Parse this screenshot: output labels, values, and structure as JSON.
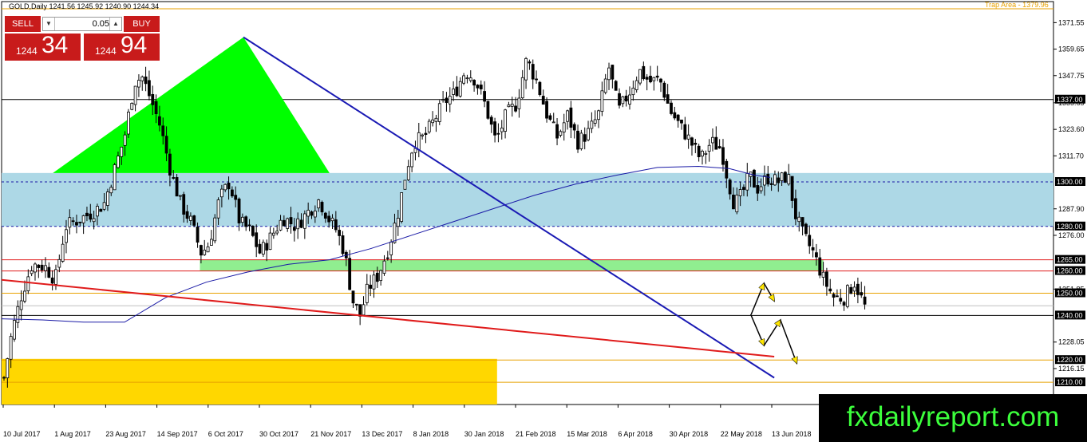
{
  "header": {
    "symbol_title": "GOLD,Daily  1241.56 1245.92 1240.90 1244.34",
    "trap_label": "Trap Area - 1379.96"
  },
  "trade_panel": {
    "sell_label": "SELL",
    "buy_label": "BUY",
    "lot_value": "0.05",
    "sell_small": "1244",
    "sell_big": "34",
    "buy_small": "1244",
    "buy_big": "94"
  },
  "watermark": "fxdailyreport.com",
  "colors": {
    "candle": "#000000",
    "ma": "#1a1aa6",
    "support_zone": "#add8e6",
    "demand_zone": "#90ee90",
    "yellow_zone": "#ffd700",
    "triangle": "#00ff00",
    "trendline": "#1a1ab4",
    "red_line": "#e01b1b",
    "orange_line": "#e8a100",
    "price_tag": "#000000"
  },
  "chart_data": {
    "type": "candlestick",
    "symbol": "GOLD",
    "timeframe": "Daily",
    "ylim": [
      1200,
      1381
    ],
    "y_ticks": [
      1216.15,
      1228.05,
      1240.0,
      1251.85,
      1263.8,
      1276.0,
      1287.9,
      1299.75,
      1311.7,
      1323.6,
      1335.55,
      1347.75,
      1359.65,
      1371.55
    ],
    "y_tick_labels": [
      "1216.15",
      "1228.05",
      "",
      "1251.85",
      "",
      "1276.00",
      "1287.90",
      "",
      "1311.70",
      "1323.60",
      "1335.65",
      "1347.75",
      "1359.65",
      "1371.55"
    ],
    "x_labels": [
      "10 Jul 2017",
      "1 Aug 2017",
      "23 Aug 2017",
      "14 Sep 2017",
      "6 Oct 2017",
      "30 Oct 2017",
      "21 Nov 2017",
      "13 Dec 2017",
      "8 Jan 2018",
      "30 Jan 2018",
      "21 Feb 2018",
      "15 Mar 2018",
      "6 Apr 2018",
      "30 Apr 2018",
      "22 May 2018",
      "13 Jun 2018"
    ],
    "price_levels": [
      {
        "label": "1337.00",
        "value": 1337.0,
        "style": "solid",
        "color": "#000000"
      },
      {
        "label": "1300.00",
        "value": 1300.0,
        "style": "dash",
        "color": "#1a1aa6"
      },
      {
        "label": "1280.00",
        "value": 1280.0,
        "style": "dash",
        "color": "#1a1aa6"
      },
      {
        "label": "1265.00",
        "value": 1265.0,
        "style": "solid",
        "color": "#e01b1b"
      },
      {
        "label": "1260.00",
        "value": 1260.0,
        "style": "solid",
        "color": "#e01b1b"
      },
      {
        "label": "1250.00",
        "value": 1250.0,
        "style": "solid",
        "color": "#e8a100"
      },
      {
        "label": "1244.34",
        "value": 1244.34,
        "style": "solid",
        "color": "#c0c0c0"
      },
      {
        "label": "1240.00",
        "value": 1240.0,
        "style": "solid",
        "color": "#000000"
      },
      {
        "label": "1220.00",
        "value": 1220.0,
        "style": "solid",
        "color": "#e8a100"
      },
      {
        "label": "1210.00",
        "value": 1210.0,
        "style": "solid",
        "color": "#e8a100"
      }
    ],
    "zones": [
      {
        "name": "blue-zone",
        "from": 1280,
        "to": 1304
      },
      {
        "name": "green-zone",
        "from": 1260,
        "to": 1265
      },
      {
        "name": "yellow-zone",
        "from": 1200,
        "to": 1220.5
      }
    ],
    "anchors": {
      "triangle": [
        [
          1.0,
          1304
        ],
        [
          4.72,
          1365
        ],
        [
          6.4,
          1304
        ]
      ],
      "blue_trend": [
        [
          4.72,
          1365
        ],
        [
          15.08,
          1212
        ]
      ],
      "red_trend": [
        [
          0,
          1256
        ],
        [
          15.08,
          1221.5
        ]
      ],
      "ma_curve": [
        [
          0,
          1238.5
        ],
        [
          0.8,
          1238
        ],
        [
          1.6,
          1237
        ],
        [
          2.4,
          1237
        ],
        [
          3.2,
          1248
        ],
        [
          4.0,
          1255
        ],
        [
          4.8,
          1259.5
        ],
        [
          5.6,
          1263
        ],
        [
          6.4,
          1265
        ],
        [
          7.2,
          1270
        ],
        [
          8.0,
          1276
        ],
        [
          8.8,
          1282
        ],
        [
          9.6,
          1288
        ],
        [
          10.4,
          1294
        ],
        [
          11.2,
          1299
        ],
        [
          12.0,
          1303
        ],
        [
          12.8,
          1306.5
        ],
        [
          13.6,
          1307
        ],
        [
          14.2,
          1306
        ],
        [
          14.7,
          1303
        ],
        [
          15.0,
          1302
        ]
      ],
      "yellow_arrows": [
        [
          [
            14.63,
            1240.5
          ],
          [
            14.88,
            1254.5
          ],
          [
            15.08,
            1246.5
          ]
        ]
      ],
      "black_arrows": [
        [
          [
            14.62,
            1240.5
          ],
          [
            14.88,
            1226.5
          ],
          [
            15.2,
            1238
          ],
          [
            15.52,
            1218.5
          ]
        ]
      ]
    },
    "close_path": [
      [
        0,
        1212
      ],
      [
        0.15,
        1232
      ],
      [
        0.35,
        1250
      ],
      [
        0.55,
        1263
      ],
      [
        0.8,
        1262
      ],
      [
        1.0,
        1256
      ],
      [
        1.2,
        1280
      ],
      [
        1.45,
        1283
      ],
      [
        1.7,
        1286
      ],
      [
        1.95,
        1290
      ],
      [
        2.15,
        1305
      ],
      [
        2.35,
        1320
      ],
      [
        2.55,
        1345
      ],
      [
        2.7,
        1347
      ],
      [
        2.85,
        1338
      ],
      [
        3.05,
        1325
      ],
      [
        3.25,
        1305
      ],
      [
        3.45,
        1290
      ],
      [
        3.65,
        1282
      ],
      [
        3.85,
        1268
      ],
      [
        4.0,
        1272
      ],
      [
        4.2,
        1292
      ],
      [
        4.4,
        1300
      ],
      [
        4.6,
        1282
      ],
      [
        4.8,
        1278
      ],
      [
        5.0,
        1268
      ],
      [
        5.2,
        1275
      ],
      [
        5.45,
        1284
      ],
      [
        5.7,
        1280
      ],
      [
        5.95,
        1287
      ],
      [
        6.15,
        1292
      ],
      [
        6.35,
        1283
      ],
      [
        6.5,
        1278
      ],
      [
        6.65,
        1268
      ],
      [
        6.8,
        1247
      ],
      [
        6.95,
        1240
      ],
      [
        7.1,
        1252
      ],
      [
        7.3,
        1258
      ],
      [
        7.5,
        1270
      ],
      [
        7.7,
        1287
      ],
      [
        7.85,
        1305
      ],
      [
        8.0,
        1318
      ],
      [
        8.2,
        1320
      ],
      [
        8.4,
        1328
      ],
      [
        8.6,
        1336
      ],
      [
        8.8,
        1340
      ],
      [
        9.0,
        1350
      ],
      [
        9.2,
        1346
      ],
      [
        9.4,
        1334
      ],
      [
        9.6,
        1318
      ],
      [
        9.8,
        1330
      ],
      [
        10.0,
        1335
      ],
      [
        10.2,
        1355
      ],
      [
        10.4,
        1345
      ],
      [
        10.6,
        1330
      ],
      [
        10.8,
        1320
      ],
      [
        11.0,
        1330
      ],
      [
        11.2,
        1318
      ],
      [
        11.4,
        1322
      ],
      [
        11.6,
        1330
      ],
      [
        11.8,
        1352
      ],
      [
        12.0,
        1332
      ],
      [
        12.2,
        1340
      ],
      [
        12.4,
        1350
      ],
      [
        12.6,
        1345
      ],
      [
        12.8,
        1346
      ],
      [
        13.0,
        1332
      ],
      [
        13.2,
        1325
      ],
      [
        13.4,
        1318
      ],
      [
        13.6,
        1310
      ],
      [
        13.8,
        1318
      ],
      [
        14.0,
        1315
      ],
      [
        14.1,
        1304
      ],
      [
        14.25,
        1290
      ],
      [
        14.4,
        1294
      ],
      [
        14.55,
        1303
      ],
      [
        14.7,
        1297
      ],
      [
        14.9,
        1302
      ],
      [
        15.1,
        1300
      ],
      [
        15.3,
        1303
      ],
      [
        15.45,
        1285
      ],
      [
        15.6,
        1276
      ],
      [
        15.8,
        1268
      ],
      [
        16.0,
        1256
      ],
      [
        16.2,
        1248
      ],
      [
        16.4,
        1248
      ],
      [
        16.6,
        1255
      ],
      [
        16.8,
        1244
      ]
    ],
    "last_price": 1244.34
  }
}
